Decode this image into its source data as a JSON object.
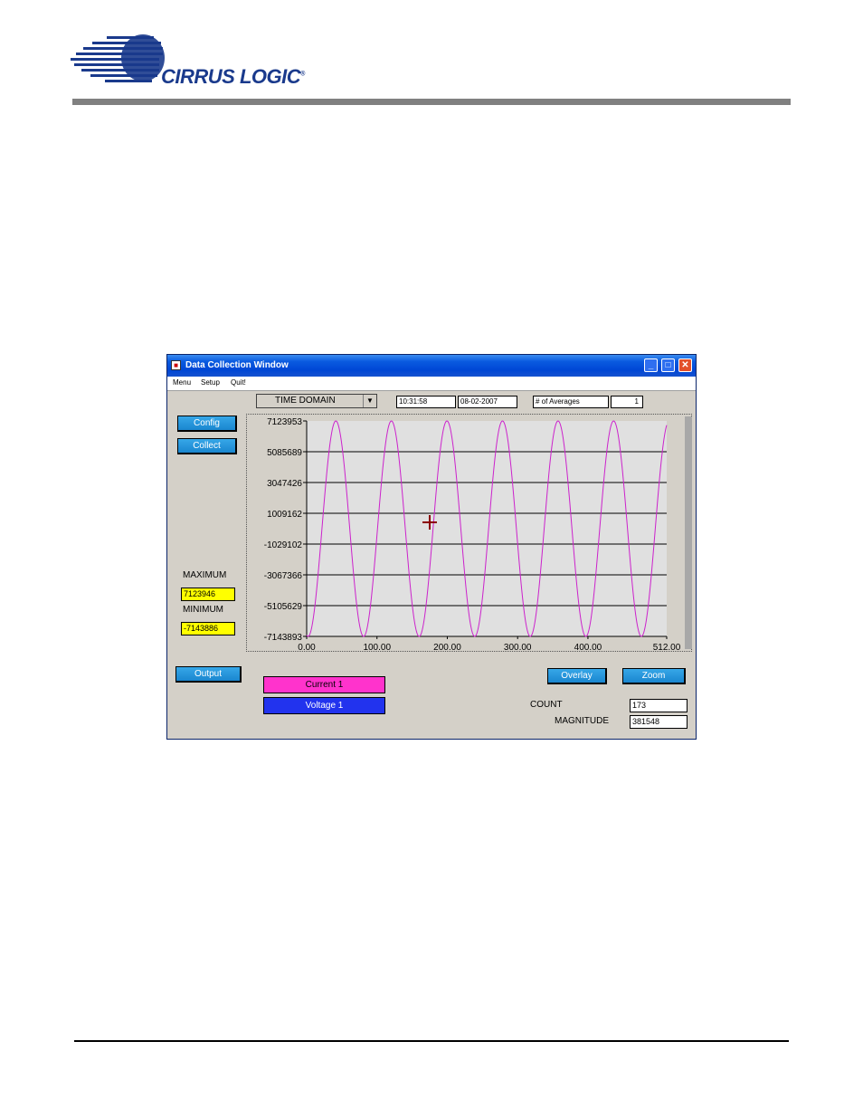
{
  "brand": {
    "name": "CIRRUS LOGIC",
    "registered": "®"
  },
  "window": {
    "title": "Data Collection Window",
    "menu": [
      "Menu",
      "Setup",
      "Quit!"
    ],
    "controls": {
      "minimize": "_",
      "maximize": "□",
      "close": "✕"
    }
  },
  "toolbar": {
    "domain_select": "TIME DOMAIN",
    "time": "10:31:58",
    "date": "08-02-2007",
    "averages_label": "# of Averages",
    "averages_value": "1"
  },
  "left_panel": {
    "config_button": "Config",
    "collect_button": "Collect",
    "maximum_label": "MAXIMUM",
    "maximum_value": "7123946",
    "minimum_label": "MINIMUM",
    "minimum_value": "-7143886",
    "output_button": "Output"
  },
  "bottom": {
    "overlay_button": "Overlay",
    "zoom_button": "Zoom",
    "count_label": "COUNT",
    "count_value": "173",
    "magnitude_label": "MAGNITUDE",
    "magnitude_value": "381548",
    "legend": [
      {
        "label": "Current 1",
        "color": "#ff33cc"
      },
      {
        "label": "Voltage 1",
        "color": "#2233ee"
      }
    ]
  },
  "colors": {
    "accent": "#1a86cf",
    "trace": "#cc22cc",
    "plot_bg": "#e0e0e0"
  },
  "chart_data": {
    "type": "line",
    "title": "",
    "xlabel": "",
    "ylabel": "",
    "x_ticks": [
      "0.00",
      "100.00",
      "200.00",
      "300.00",
      "400.00",
      "512.00"
    ],
    "x_tick_values": [
      0,
      100,
      200,
      300,
      400,
      512
    ],
    "y_ticks": [
      "7123953",
      "5085689",
      "3047426",
      "1009162",
      "-1029102",
      "-3067366",
      "-5105629",
      "-7143893"
    ],
    "y_tick_values": [
      7123953,
      5085689,
      3047426,
      1009162,
      -1029102,
      -3067366,
      -5105629,
      -7143893
    ],
    "xlim": [
      0,
      512
    ],
    "ylim": [
      -7143893,
      7123953
    ],
    "grid": true,
    "series": [
      {
        "name": "Current 1",
        "color": "#cc22cc",
        "wave": {
          "type": "sine",
          "amplitude": 7133920,
          "offset": -9970,
          "period_samples": 79,
          "phase_samples": 2
        }
      }
    ]
  }
}
